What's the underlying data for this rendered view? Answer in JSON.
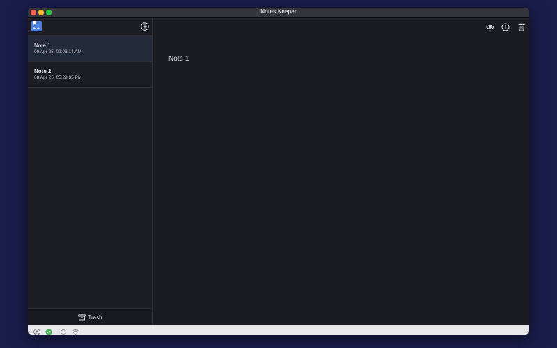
{
  "window": {
    "title": "Notes Keeper"
  },
  "sidebar": {
    "logo_icon": "notes-app-logo-icon",
    "add_icon": "plus-circle-icon",
    "notes": [
      {
        "title": "Note 1",
        "date": "09 Apr 25, 09:06:14 AM",
        "selected": true
      },
      {
        "title": "Note 2",
        "date": "08 Apr 25, 05:29:35 PM",
        "selected": false
      }
    ],
    "trash_label": "Trash",
    "trash_icon": "trash-box-icon"
  },
  "toolbar": {
    "icons": [
      "eye-icon",
      "info-icon",
      "trash-icon"
    ]
  },
  "editor": {
    "content": "Note 1"
  },
  "statusbar": {
    "icons": [
      "user-icon",
      "check-icon",
      "sync-icon",
      "wifi-icon"
    ]
  },
  "colors": {
    "accent": "#4a7fe0",
    "selected_row": "#232a3a",
    "success": "#3eb34f",
    "desktop": "#191d4a"
  }
}
